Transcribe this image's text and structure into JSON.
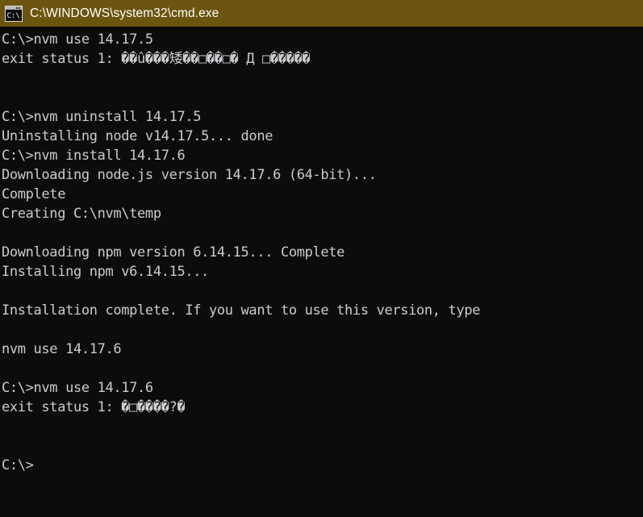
{
  "window": {
    "title": "C:\\WINDOWS\\system32\\cmd.exe",
    "icon": "cmd-console-icon",
    "titlebar_color": "#6b550f",
    "titlebar_text_color": "#ffffff",
    "background_color": "#0c0c0c",
    "text_color": "#ccccd0"
  },
  "console": {
    "prompt": "C:\\>",
    "lines": [
      {
        "id": "cmd-nvm-use-14-17-5",
        "text": "C:\\>nvm use 14.17.5"
      },
      {
        "id": "exit-status-1-mojibake-a",
        "text": "exit status 1: ��û���矮��□��□� Д □�����"
      },
      {
        "id": "blank-1",
        "text": ""
      },
      {
        "id": "blank-2",
        "text": ""
      },
      {
        "id": "cmd-nvm-uninstall",
        "text": "C:\\>nvm uninstall 14.17.5"
      },
      {
        "id": "out-uninstalling-done",
        "text": "Uninstalling node v14.17.5... done"
      },
      {
        "id": "cmd-nvm-install",
        "text": "C:\\>nvm install 14.17.6"
      },
      {
        "id": "out-downloading-node",
        "text": "Downloading node.js version 14.17.6 (64-bit)..."
      },
      {
        "id": "out-complete",
        "text": "Complete"
      },
      {
        "id": "out-creating-temp",
        "text": "Creating C:\\nvm\\temp"
      },
      {
        "id": "blank-3",
        "text": ""
      },
      {
        "id": "out-downloading-npm",
        "text": "Downloading npm version 6.14.15... Complete"
      },
      {
        "id": "out-installing-npm",
        "text": "Installing npm v6.14.15..."
      },
      {
        "id": "blank-4",
        "text": ""
      },
      {
        "id": "out-installation-complete",
        "text": "Installation complete. If you want to use this version, type"
      },
      {
        "id": "blank-5",
        "text": ""
      },
      {
        "id": "out-hint-nvm-use",
        "text": "nvm use 14.17.6"
      },
      {
        "id": "blank-6",
        "text": ""
      },
      {
        "id": "cmd-nvm-use-14-17-6",
        "text": "C:\\>nvm use 14.17.6"
      },
      {
        "id": "exit-status-1-mojibake-b",
        "text": "exit status 1: �□����?�"
      },
      {
        "id": "blank-7",
        "text": ""
      },
      {
        "id": "blank-8",
        "text": ""
      },
      {
        "id": "prompt-final",
        "text": "C:\\>"
      }
    ]
  }
}
